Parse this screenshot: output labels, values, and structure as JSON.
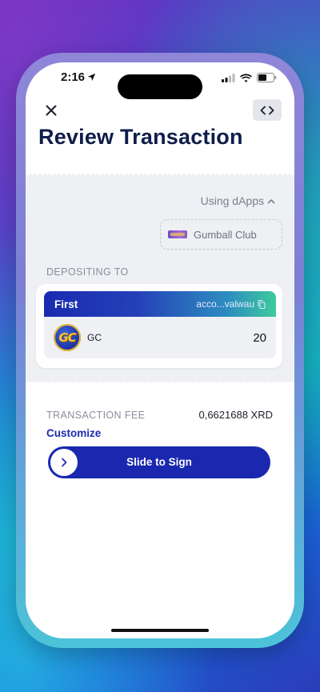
{
  "status_bar": {
    "time": "2:16"
  },
  "header": {
    "title": "Review Transaction"
  },
  "dapps": {
    "toggle_label": "Using dApps",
    "items": [
      {
        "name": "Gumball Club"
      }
    ]
  },
  "deposit": {
    "section_label": "DEPOSITING TO",
    "account": {
      "name": "First",
      "address": "acco...valwau"
    },
    "tokens": [
      {
        "symbol": "GC",
        "logo_text": "GC",
        "amount": "20"
      }
    ]
  },
  "fee": {
    "label": "TRANSACTION FEE",
    "value": "0,6621688 XRD",
    "customize_label": "Customize"
  },
  "slider": {
    "label": "Slide to Sign"
  },
  "colors": {
    "accent": "#1a28b0",
    "title": "#0f1d4a",
    "panel": "#eff0f4"
  }
}
